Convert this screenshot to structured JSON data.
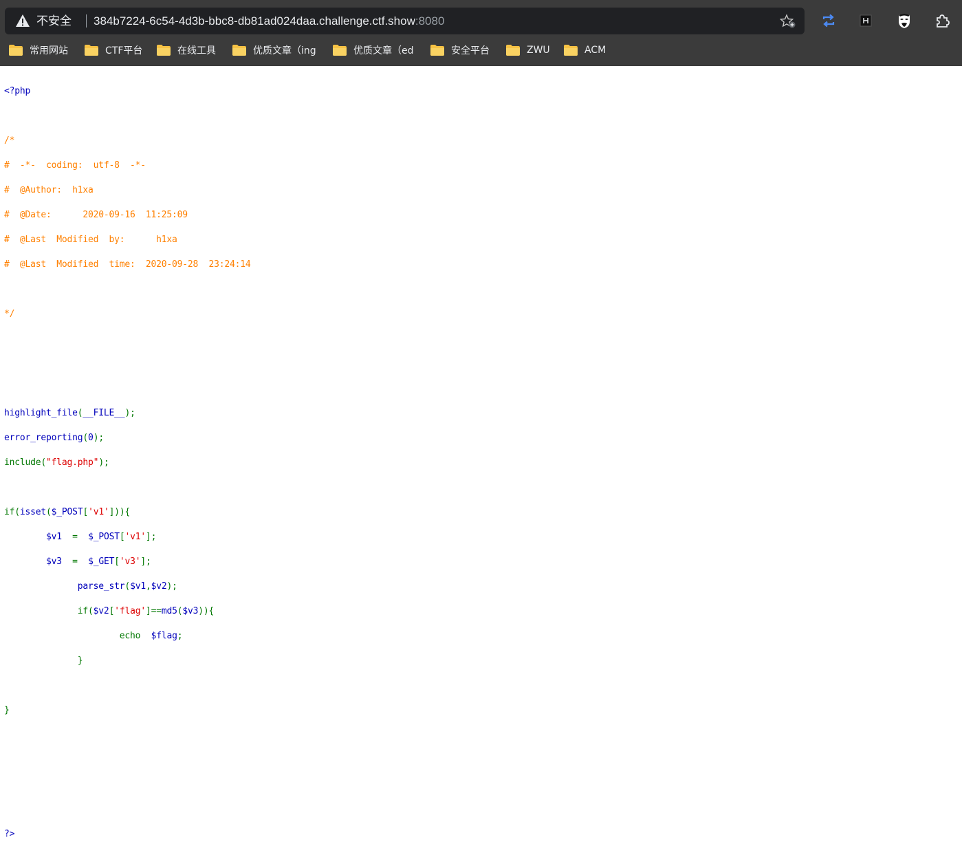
{
  "browser": {
    "security_label": "不安全",
    "url_host": "384b7224-6c54-4d3b-bbc8-db81ad024daa.challenge.ctf.show",
    "url_port": ":8080",
    "icons": {
      "warning": "warning-triangle-icon",
      "favorite": "star-plus-icon",
      "ext1": "sync-arrows-icon",
      "ext2": "h-badge-icon",
      "ext3": "mask-icon",
      "ext4": "puzzle-icon"
    },
    "accent_color": "#4c8bf5"
  },
  "bookmarks": [
    {
      "label": "常用网站"
    },
    {
      "label": "CTF平台"
    },
    {
      "label": "在线工具"
    },
    {
      "label": "优质文章（ing"
    },
    {
      "label": "优质文章（ed"
    },
    {
      "label": "安全平台"
    },
    {
      "label": "ZWU"
    },
    {
      "label": "ACM"
    }
  ],
  "source": {
    "open_tag": "<?php",
    "comment": [
      "/*",
      "#  -*-  coding:  utf-8  -*-",
      "#  @Author:  h1xa",
      "#  @Date:      2020-09-16  11:25:09",
      "#  @Last  Modified  by:      h1xa",
      "#  @Last  Modified  time:  2020-09-28  23:24:14",
      "",
      "*/"
    ],
    "line_highlight": {
      "fn": "highlight_file",
      "open": "(",
      "arg": "__FILE__",
      "close": ");"
    },
    "line_error": {
      "fn": "error_reporting",
      "open": "(",
      "arg": "0",
      "close": ");"
    },
    "line_include": {
      "fn": "include",
      "open": "(",
      "arg": "\"flag.php\"",
      "close": ");"
    },
    "line_if": {
      "kw": "if(",
      "fn": "isset",
      "p1": "(",
      "var": "$_POST",
      "b1": "[",
      "key": "'v1'",
      "b2": "])){"
    },
    "line_v1": {
      "var": "$v1",
      "eq": "=",
      "src": "$_POST",
      "b1": "[",
      "key": "'v1'",
      "b2": "];"
    },
    "line_v3": {
      "var": "$v3",
      "eq": "=",
      "src": "$_GET",
      "b1": "[",
      "key": "'v3'",
      "b2": "];"
    },
    "line_parse": {
      "fn": "parse_str",
      "p1": "(",
      "a1": "$v1",
      "comma": ",",
      "a2": "$v2",
      "p2": ");"
    },
    "line_if2": {
      "kw": "if(",
      "var": "$v2",
      "b1": "[",
      "key": "'flag'",
      "b2": "]==",
      "fn": "md5",
      "p1": "(",
      "arg": "$v3",
      "p2": ")){"
    },
    "line_echo": {
      "kw": "echo",
      "var": "$flag",
      "semi": ";"
    },
    "close_inner": "}",
    "close_outer": "}",
    "close_tag": "?>"
  }
}
